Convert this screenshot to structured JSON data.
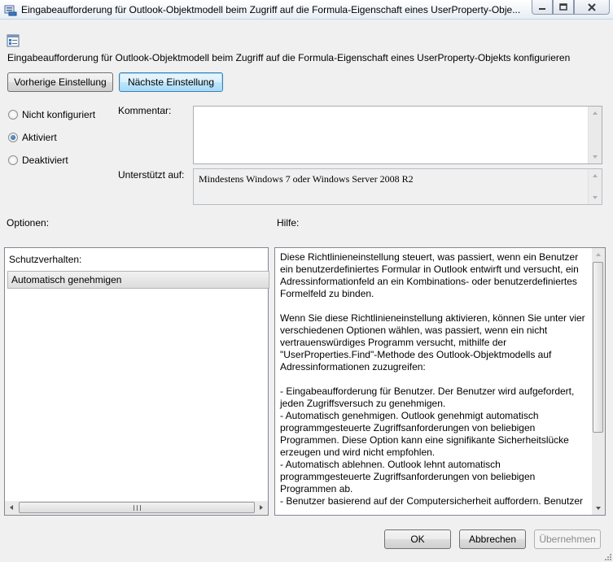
{
  "window": {
    "title": "Eingabeaufforderung für Outlook-Objektmodell beim Zugriff auf die Formula-Eigenschaft eines UserProperty-Obje..."
  },
  "policy": {
    "description": "Eingabeaufforderung für Outlook-Objektmodell beim Zugriff auf die Formula-Eigenschaft eines UserProperty-Objekts konfigurieren"
  },
  "nav": {
    "previous_label": "Vorherige Einstellung",
    "next_label": "Nächste Einstellung"
  },
  "state": {
    "options": [
      {
        "label": "Nicht konfiguriert",
        "checked": false
      },
      {
        "label": "Aktiviert",
        "checked": true
      },
      {
        "label": "Deaktiviert",
        "checked": false
      }
    ]
  },
  "comment": {
    "label": "Kommentar:",
    "value": ""
  },
  "supported": {
    "label": "Unterstützt auf:",
    "value": "Mindestens Windows 7 oder Windows Server 2008 R2"
  },
  "options_section": {
    "header": "Optionen:",
    "protection_label": "Schutzverhalten:",
    "protection_value": "Automatisch genehmigen"
  },
  "help_section": {
    "header": "Hilfe:",
    "paragraphs": [
      "Diese Richtlinieneinstellung steuert, was passiert, wenn ein Benutzer ein benutzerdefiniertes Formular in Outlook entwirft und versucht, ein Adressinformationfeld an ein Kombinations- oder benutzerdefiniertes Formelfeld zu binden.",
      "Wenn Sie diese Richtlinieneinstellung aktivieren, können Sie unter vier verschiedenen Optionen wählen, was passiert, wenn ein nicht vertrauenswürdiges Programm versucht, mithilfe der \"UserProperties.Find\"-Methode des Outlook-Objektmodells auf Adressinformationen zuzugreifen:",
      "- Eingabeaufforderung für Benutzer. Der Benutzer wird aufgefordert, jeden Zugriffsversuch zu genehmigen.",
      "- Automatisch genehmigen. Outlook genehmigt automatisch programmgesteuerte Zugriffsanforderungen von beliebigen Programmen. Diese Option kann eine signifikante Sicherheitslücke erzeugen und wird nicht empfohlen.",
      "- Automatisch ablehnen. Outlook lehnt automatisch programmgesteuerte Zugriffsanforderungen von beliebigen Programmen ab.",
      "- Benutzer basierend auf der Computersicherheit auffordern. Benutzer"
    ]
  },
  "footer": {
    "ok_label": "OK",
    "cancel_label": "Abbrechen",
    "apply_label": "Übernehmen"
  }
}
